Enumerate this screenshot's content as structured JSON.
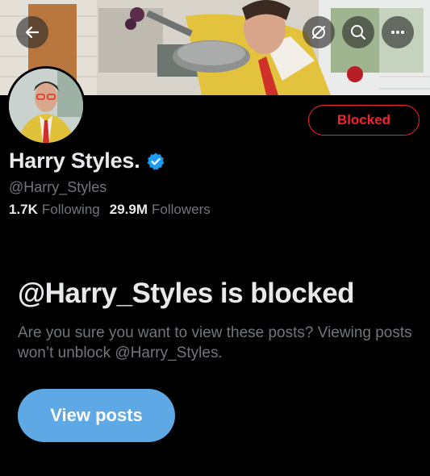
{
  "profile": {
    "name": "Harry Styles.",
    "handle": "@Harry_Styles",
    "following_count": "1.7K",
    "following_label": "Following",
    "followers_count": "29.9M",
    "followers_label": "Followers",
    "blocked_label": "Blocked",
    "verified": true
  },
  "header_icons": [
    "back-arrow-icon",
    "hide-reposts-icon",
    "search-icon",
    "more-icon"
  ],
  "blocked_notice": {
    "title": "@Harry_Styles is blocked",
    "description": "Are you sure you want to view these posts? Viewing posts won’t unblock @Harry_Styles.",
    "button_label": "View posts"
  },
  "colors": {
    "background": "#000000",
    "text_primary": "#e7e9ea",
    "text_secondary": "#71767b",
    "danger": "#f4212e",
    "verified_blue": "#1d9bf0",
    "button_blue": "#5fa8e6"
  }
}
